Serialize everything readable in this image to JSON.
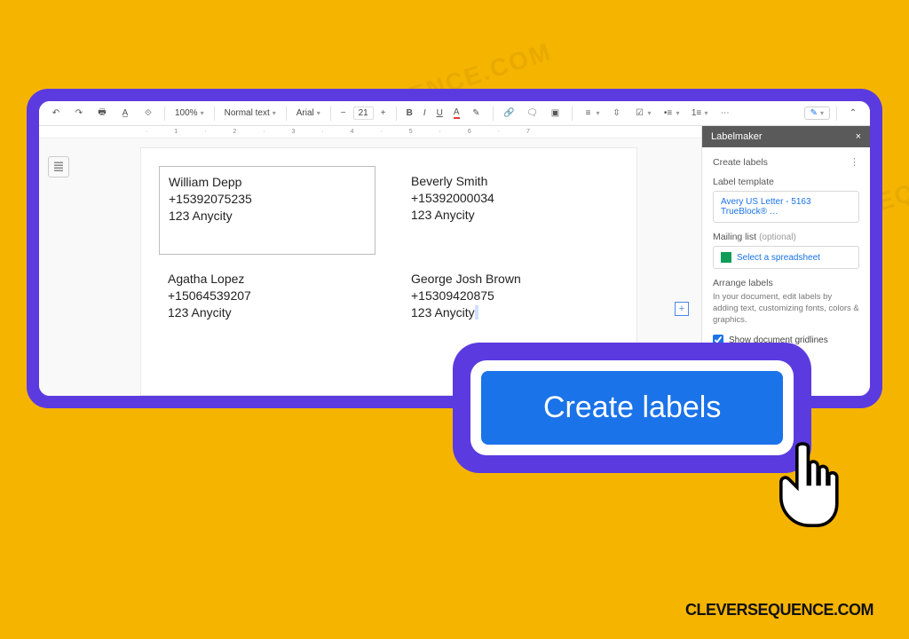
{
  "toolbar": {
    "zoom": "100%",
    "style": "Normal text",
    "font": "Arial",
    "size": "21"
  },
  "sidebar": {
    "title": "Labelmaker",
    "create_heading": "Create labels",
    "template_heading": "Label template",
    "template_value": "Avery US Letter - 5163 TrueBlock® …",
    "mailing_heading": "Mailing list",
    "mailing_optional": "(optional)",
    "select_sheet": "Select a spreadsheet",
    "arrange_heading": "Arrange labels",
    "arrange_desc": "In your document, edit labels by adding text, customizing fonts, colors & graphics.",
    "gridlines": "Show document gridlines"
  },
  "labels": [
    {
      "name": "William Depp",
      "phone": "+15392075235",
      "city": "123 Anycity"
    },
    {
      "name": "Beverly Smith",
      "phone": "+15392000034",
      "city": "123 Anycity"
    },
    {
      "name": "Agatha Lopez",
      "phone": "+15064539207",
      "city": "123 Anycity"
    },
    {
      "name": "George Josh Brown",
      "phone": "+15309420875",
      "city": "123 Anycity"
    }
  ],
  "callout": {
    "button": "Create labels"
  },
  "brand": "CLEVERSEQUENCE.COM",
  "watermark": "CLEVERSEQUENCE.COM"
}
